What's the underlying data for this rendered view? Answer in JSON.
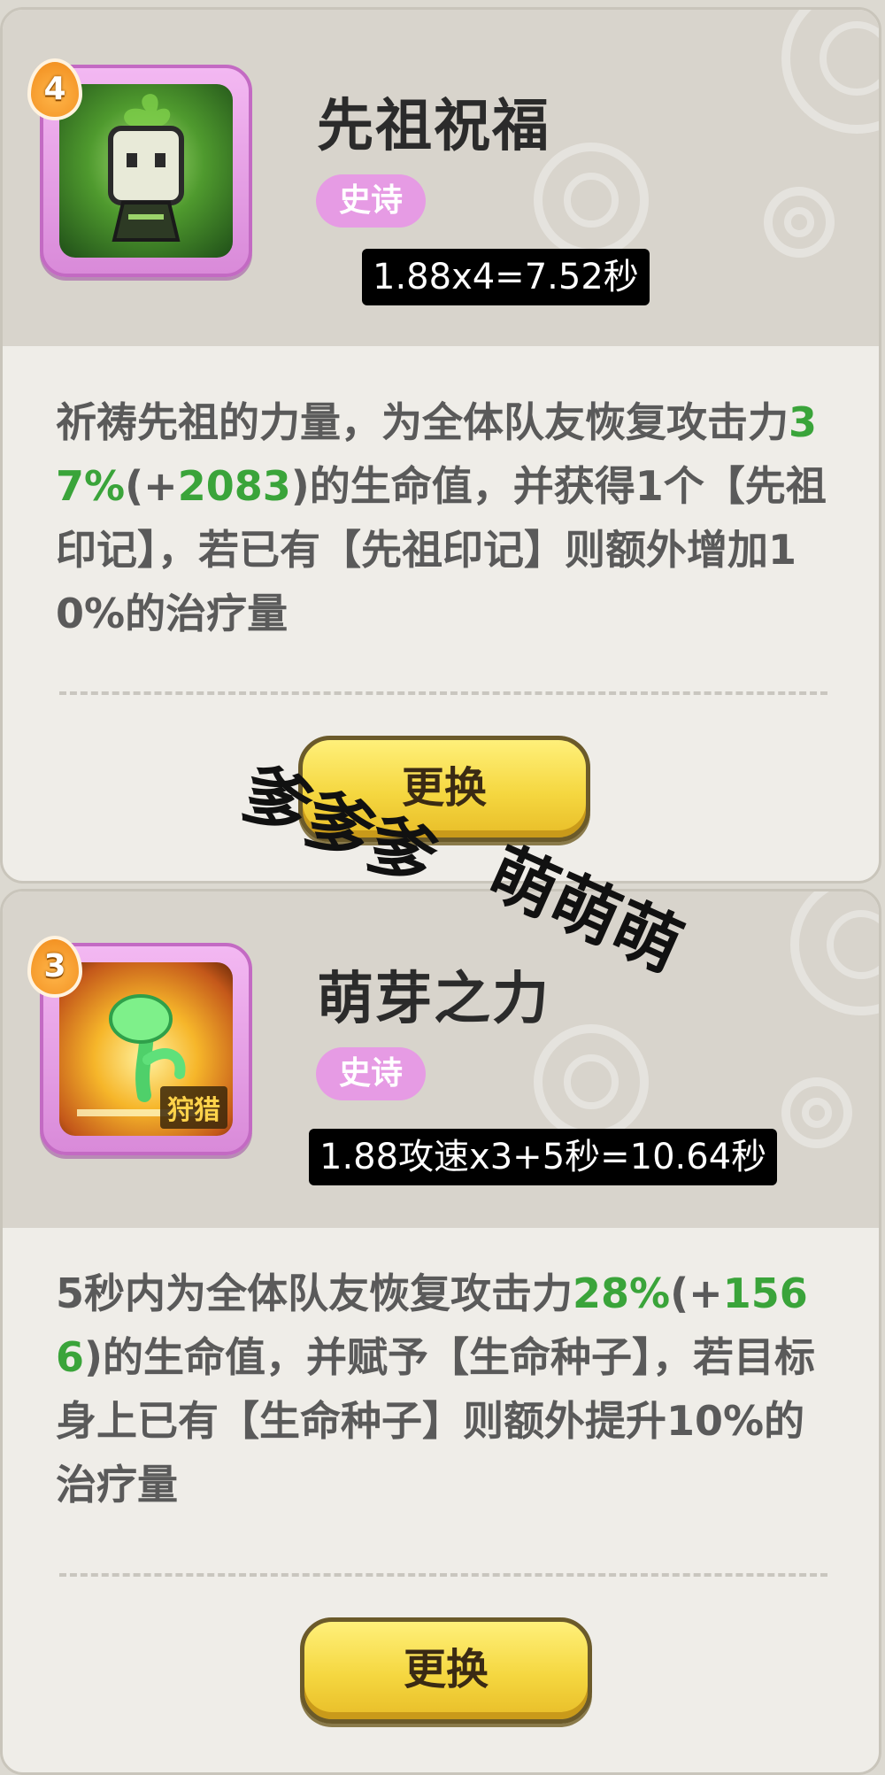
{
  "colors": {
    "card_bg": "#efede8",
    "header_bg": "#d8d4cc",
    "rarity_bg": "#e69be4",
    "highlight_green": "#3aa43a",
    "button_yellow": "#f5d740"
  },
  "cards": [
    {
      "level": "4",
      "icon": "ancestor-spirit-icon",
      "title": "先祖祝福",
      "rarity": "史诗",
      "formula": "1.88x4=7.52秒",
      "desc": {
        "p1": "祈祷先祖的力量，为全体队友恢复攻击力",
        "pct": "37%",
        "p2": "(+",
        "num": "2083",
        "p3": ")的生命值，并获得1个【先祖印记】，若已有【先祖印记】则额外增加10%的治疗量"
      },
      "button_label": "更换"
    },
    {
      "level": "3",
      "icon": "sprout-icon",
      "tag": "狩猎",
      "title": "萌芽之力",
      "rarity": "史诗",
      "formula": "1.88攻速x3+5秒=10.64秒",
      "desc": {
        "p1": "5秒内为全体队友恢复攻击力",
        "pct": "28%",
        "p2": "(+",
        "num": "1566",
        "p3": ")的生命值，并赋予【生命种子】，若目标身上已有【生命种子】则额外提升10%的治疗量"
      },
      "button_label": "更换"
    }
  ],
  "watermark": {
    "line1": "爹爹爹",
    "line2": "萌萌萌"
  }
}
